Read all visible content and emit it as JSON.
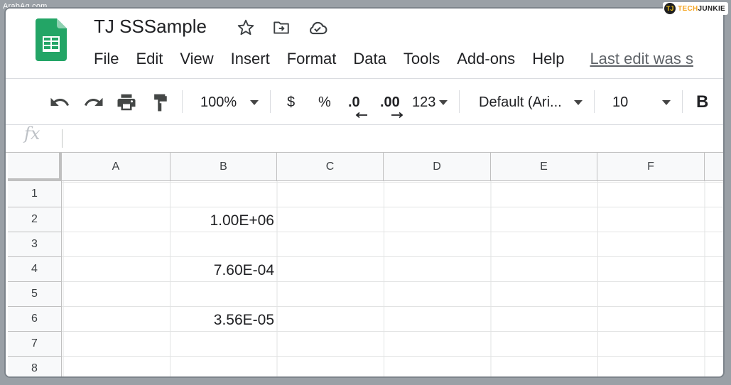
{
  "watermark": {
    "left_text": "ArabAq.com",
    "brand_mark": "TJ",
    "brand_text_a": "TECH",
    "brand_text_b": "JUNKIE"
  },
  "document": {
    "title": "TJ SSSample"
  },
  "menu": [
    "File",
    "Edit",
    "View",
    "Insert",
    "Format",
    "Data",
    "Tools",
    "Add-ons",
    "Help"
  ],
  "last_edit": "Last edit was s",
  "toolbar": {
    "zoom": "100%",
    "currency": "$",
    "percent": "%",
    "decrease_decimal": ".0",
    "increase_decimal": ".00",
    "more_formats": "123",
    "font": "Default (Ari...",
    "font_size": "10",
    "bold": "B"
  },
  "formula_bar": {
    "fx_label": "fx"
  },
  "colors": {
    "sheets_green": "#188038",
    "toolbar_icon": "#444746",
    "grid_line": "#e2e3e3",
    "header_bg": "#f8f9fa"
  },
  "sheet": {
    "columns": [
      "A",
      "B",
      "C",
      "D",
      "E",
      "F"
    ],
    "rows": [
      "1",
      "2",
      "3",
      "4",
      "5",
      "6",
      "7",
      "8"
    ],
    "cells": {
      "B2": "1.00E+06",
      "B4": "7.60E-04",
      "B6": "3.56E-05"
    }
  }
}
